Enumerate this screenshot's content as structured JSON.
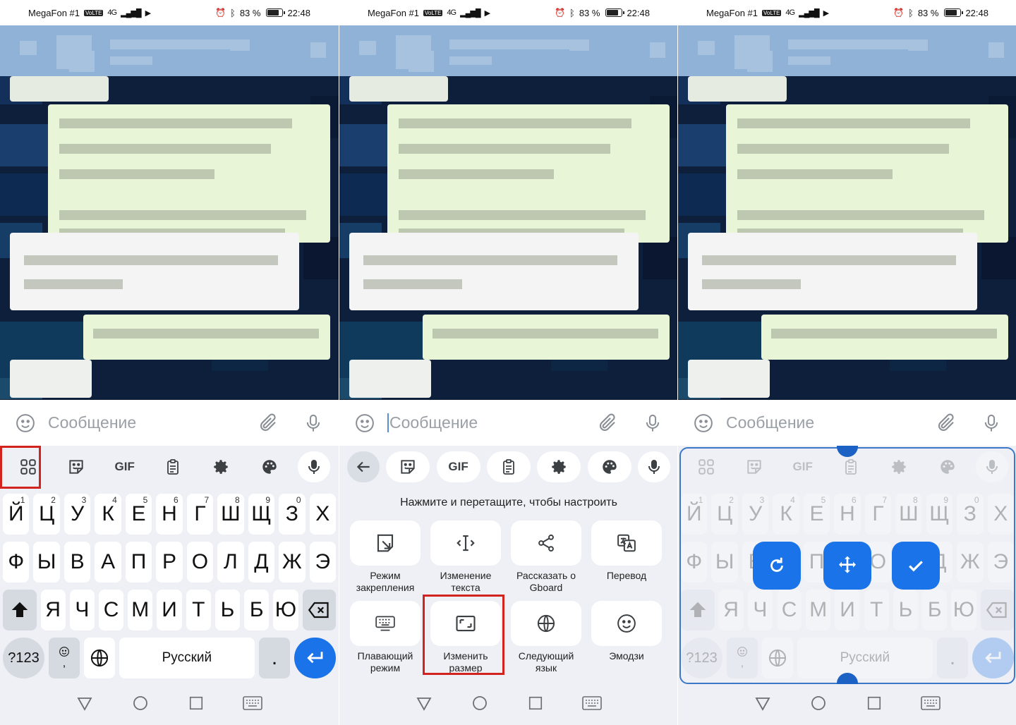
{
  "status_bar": {
    "carrier": "MegaFon #1",
    "volte": "VoLTE",
    "network": "4G",
    "battery": "83 %",
    "time": "22:48"
  },
  "message_bar": {
    "placeholder": "Сообщение"
  },
  "toolbar": {
    "gif_label": "GIF"
  },
  "keyboard": {
    "row1": [
      {
        "k": "Й",
        "s": "1"
      },
      {
        "k": "Ц",
        "s": "2"
      },
      {
        "k": "У",
        "s": "3"
      },
      {
        "k": "К",
        "s": "4"
      },
      {
        "k": "Е",
        "s": "5"
      },
      {
        "k": "Н",
        "s": "6"
      },
      {
        "k": "Г",
        "s": "7"
      },
      {
        "k": "Ш",
        "s": "8"
      },
      {
        "k": "Щ",
        "s": "9"
      },
      {
        "k": "З",
        "s": "0"
      },
      {
        "k": "Х",
        "s": ""
      }
    ],
    "row2": [
      "Ф",
      "Ы",
      "В",
      "А",
      "П",
      "Р",
      "О",
      "Л",
      "Д",
      "Ж",
      "Э"
    ],
    "row3": [
      "Я",
      "Ч",
      "С",
      "М",
      "И",
      "Т",
      "Ь",
      "Б",
      "Ю"
    ],
    "num_label": "?123",
    "comma": ",",
    "period": ".",
    "space_label": "Русский"
  },
  "menu": {
    "title": "Нажмите и перетащите, чтобы настроить",
    "items": [
      {
        "label": "Режим закрепления",
        "icon": "pin-mode-icon"
      },
      {
        "label": "Изменение текста",
        "icon": "text-edit-icon"
      },
      {
        "label": "Рассказать о Gboard",
        "icon": "share-icon"
      },
      {
        "label": "Перевод",
        "icon": "translate-icon"
      },
      {
        "label": "Плавающий режим",
        "icon": "floating-keyboard-icon"
      },
      {
        "label": "Изменить размер",
        "icon": "resize-icon"
      },
      {
        "label": "Следующий язык",
        "icon": "globe-icon"
      },
      {
        "label": "Эмодзи",
        "icon": "emoji-icon"
      }
    ]
  },
  "colors": {
    "accent": "#1a73e8",
    "highlight": "#d3231f",
    "frame": "#3b78c7"
  }
}
